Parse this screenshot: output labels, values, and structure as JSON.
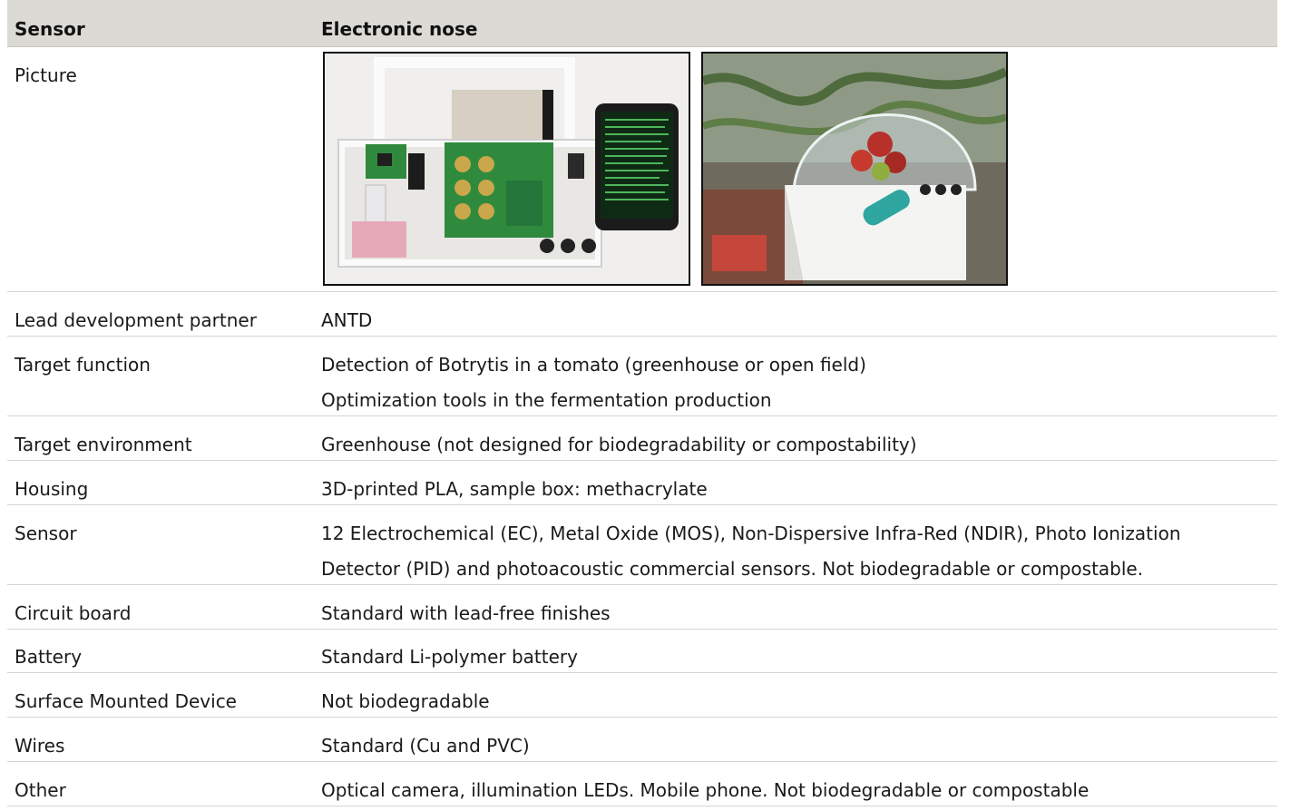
{
  "header": {
    "col1": "Sensor",
    "col2": "Electronic nose"
  },
  "picture_row": {
    "label": "Picture"
  },
  "rows": [
    {
      "label": "Lead development partner",
      "lines": [
        "ANTD"
      ]
    },
    {
      "label": "Target function",
      "lines": [
        "Detection of Botrytis in a tomato (greenhouse or open field)",
        "Optimization tools in the fermentation production"
      ]
    },
    {
      "label": "Target environment",
      "lines": [
        "Greenhouse (not designed for biodegradability or compostability)"
      ]
    },
    {
      "label": "Housing",
      "lines": [
        "3D-printed PLA, sample box: methacrylate"
      ]
    },
    {
      "label": "Sensor",
      "lines": [
        "12 Electrochemical (EC), Metal Oxide (MOS), Non-Dispersive Infra-Red (NDIR), Photo Ionization",
        "Detector (PID) and photoacoustic commercial sensors. Not biodegradable or compostable."
      ]
    },
    {
      "label": "Circuit board",
      "lines": [
        "Standard with lead-free finishes"
      ]
    },
    {
      "label": "Battery",
      "lines": [
        "Standard Li-polymer battery"
      ]
    },
    {
      "label": "Surface Mounted Device",
      "lines": [
        "Not biodegradable"
      ]
    },
    {
      "label": "Wires",
      "lines": [
        "Standard (Cu and PVC)"
      ]
    },
    {
      "label": "Other",
      "lines": [
        "Optical camera, illumination LEDs. Mobile phone. Not biodegradable or compostable"
      ]
    }
  ]
}
